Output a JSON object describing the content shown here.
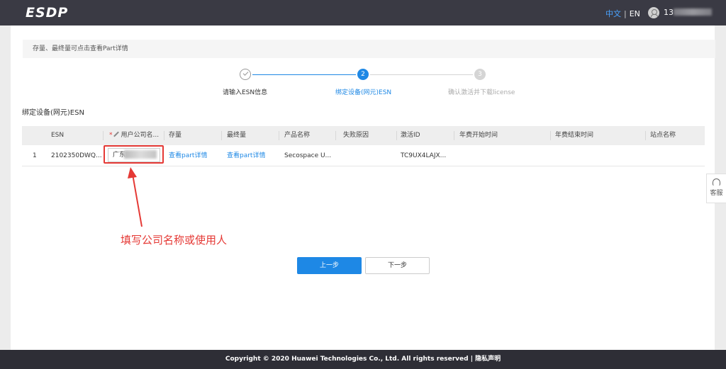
{
  "header": {
    "logo": "ESDP",
    "lang_cn": "中文",
    "lang_sep": "|",
    "lang_en": "EN",
    "user_prefix": "13"
  },
  "notice": {
    "text": "存量、最终量可点击查看Part详情"
  },
  "steps": [
    {
      "number": "",
      "label": "请输入ESN信息",
      "state": "done"
    },
    {
      "number": "2",
      "label": "绑定设备(网元)ESN",
      "state": "active"
    },
    {
      "number": "3",
      "label": "确认激活并下载license",
      "state": "pending"
    }
  ],
  "section_title": "绑定设备(网元)ESN",
  "table": {
    "columns": {
      "index": "",
      "esn": "ESN",
      "required_mark": "*",
      "company": "用户公司名...",
      "stock": "存量",
      "final": "最终量",
      "product": "产品名称",
      "fail_reason": "失败原因",
      "activation_id": "激活ID",
      "year_start": "年费开始时间",
      "year_end": "年费结束时间",
      "site": "站点名称"
    },
    "rows": [
      {
        "index": "1",
        "esn": "2102350DWQ...",
        "company": "广东",
        "stock": "查看part详情",
        "final": "查看part详情",
        "product": "Secospace U...",
        "fail_reason": "",
        "activation_id": "TC9UX4LAJX...",
        "year_start": "",
        "year_end": "",
        "site": ""
      }
    ]
  },
  "annotation": "填写公司名称或使用人",
  "buttons": {
    "prev": "上一步",
    "next": "下一步"
  },
  "service": {
    "label": "客服"
  },
  "footer": {
    "text": "Copyright © 2020 Huawei Technologies Co., Ltd. All rights reserved | 隐私声明"
  },
  "colors": {
    "accent": "#1e88e5",
    "annotation": "#e53935",
    "topbar": "#3a3a44"
  }
}
